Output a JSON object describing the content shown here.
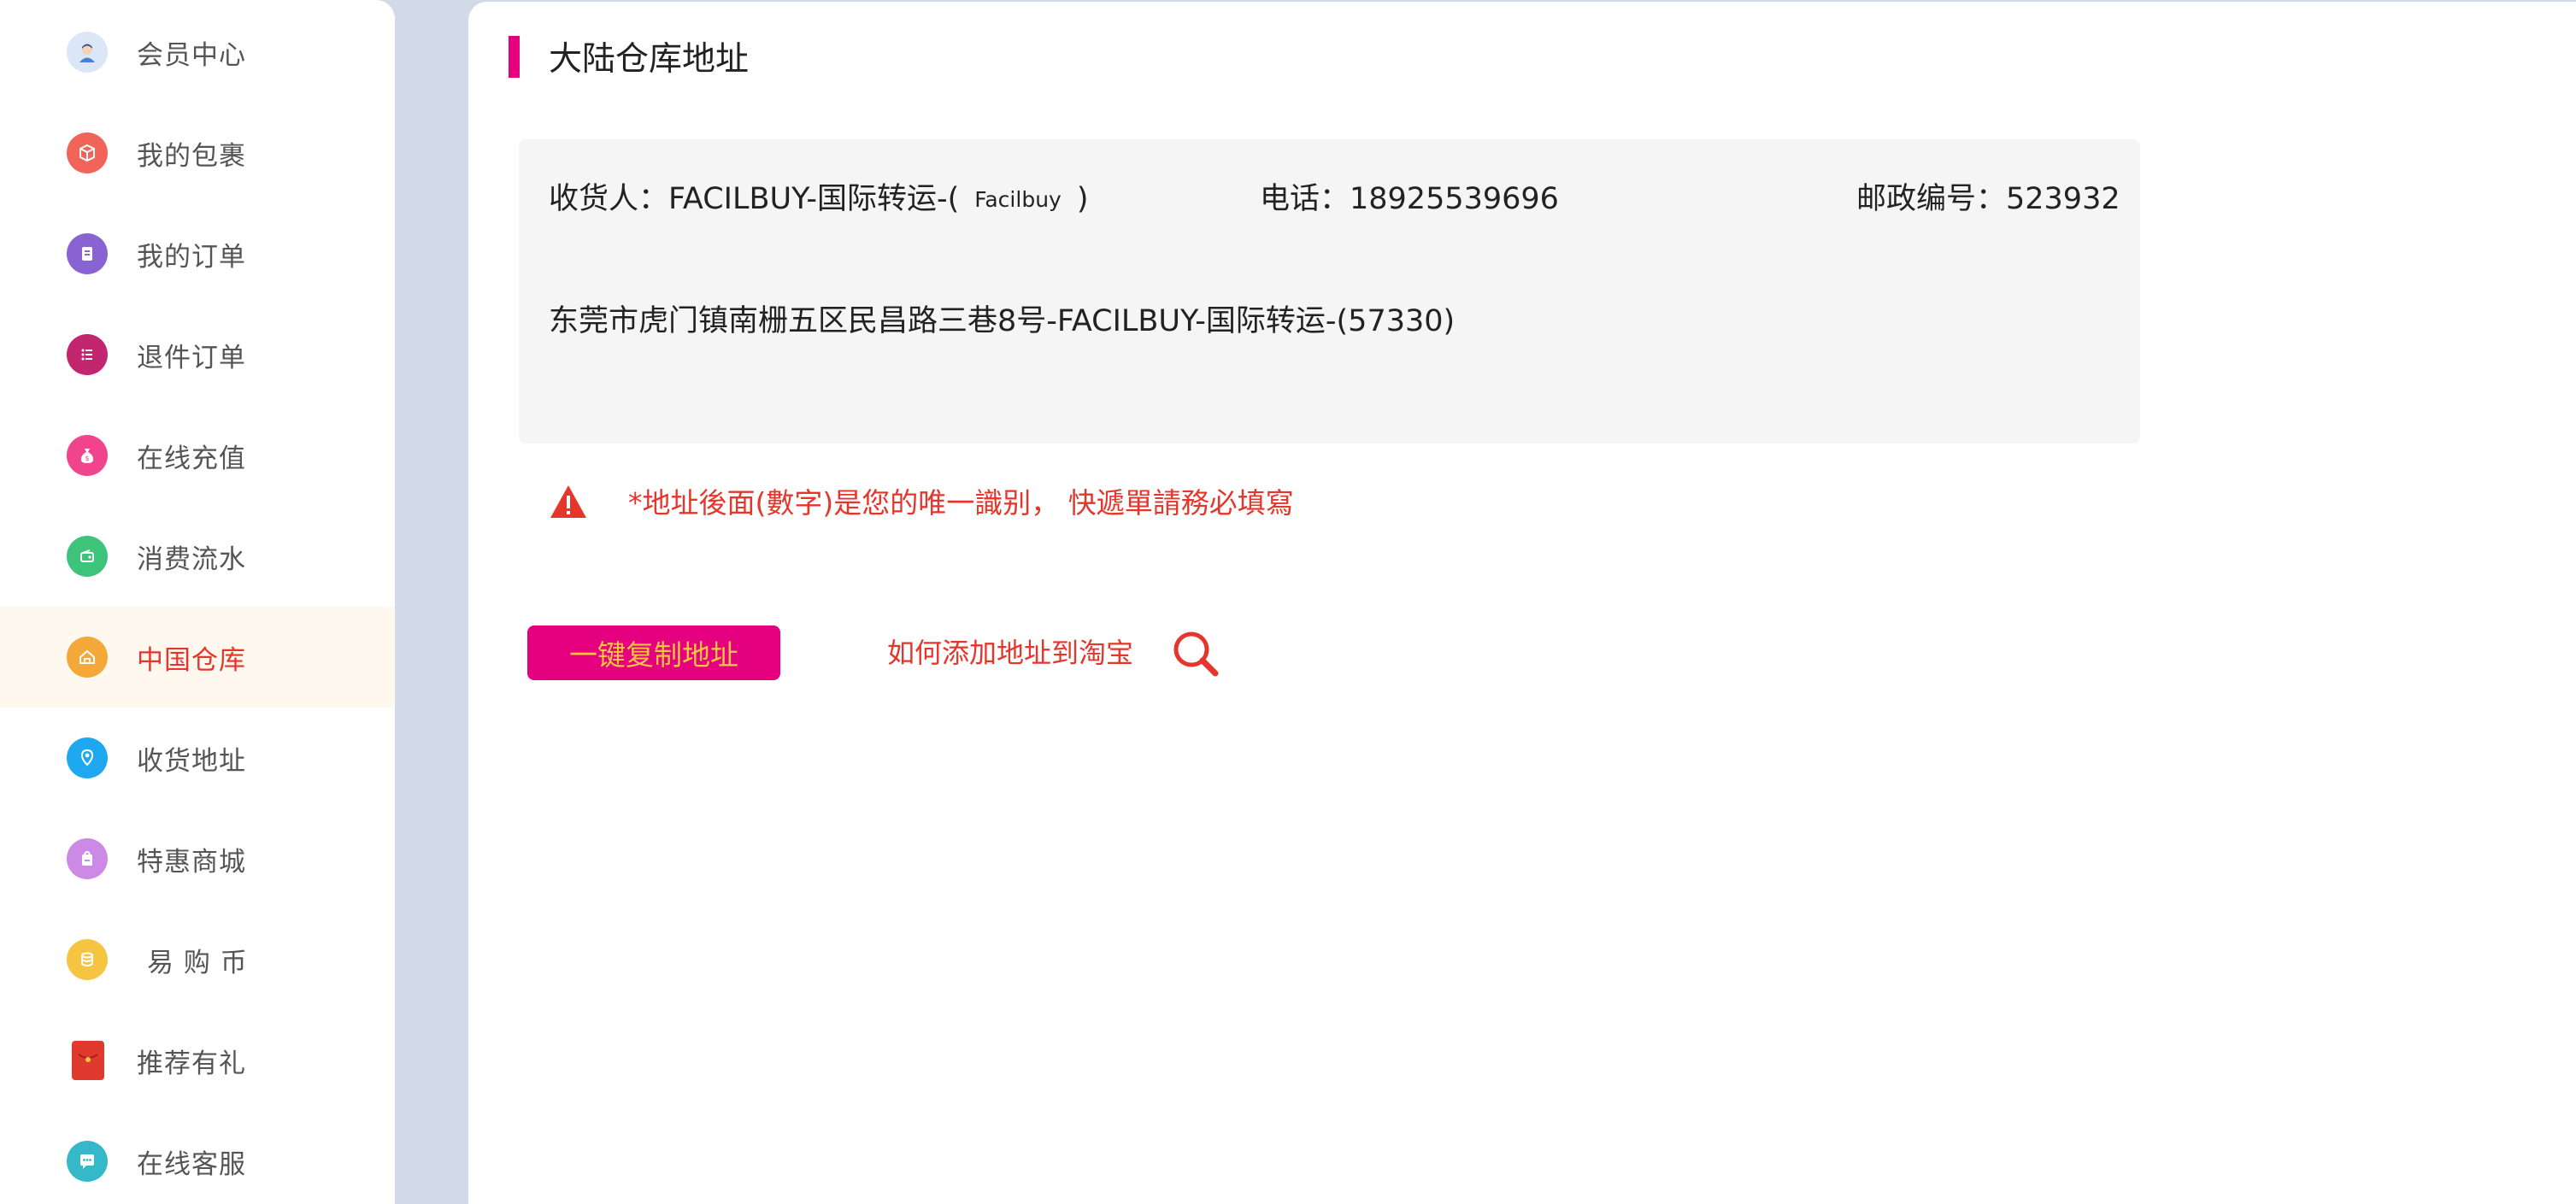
{
  "sidebar": {
    "items": [
      {
        "label": "会员中心",
        "icon": "avatar-icon",
        "color": "#8fb3e6",
        "active": false
      },
      {
        "label": "我的包裹",
        "icon": "package-icon",
        "color": "#f0645a",
        "active": false
      },
      {
        "label": "我的订单",
        "icon": "order-icon",
        "color": "#8a63d2",
        "active": false
      },
      {
        "label": "退件订单",
        "icon": "return-list-icon",
        "color": "#c2266f",
        "active": false
      },
      {
        "label": "在线充值",
        "icon": "money-bag-icon",
        "color": "#f0448c",
        "active": false
      },
      {
        "label": "消费流水",
        "icon": "wallet-flow-icon",
        "color": "#3ec47a",
        "active": false
      },
      {
        "label": "中国仓库",
        "icon": "warehouse-icon",
        "color": "#f5a83a",
        "active": true
      },
      {
        "label": "收货地址",
        "icon": "location-pin-icon",
        "color": "#1ea8f0",
        "active": false
      },
      {
        "label": "特惠商城",
        "icon": "shopping-bag-icon",
        "color": "#cc8ae6",
        "active": false
      },
      {
        "label": "易 购 币",
        "icon": "coin-icon",
        "color": "#f5c542",
        "active": false
      },
      {
        "label": "推荐有礼",
        "icon": "red-envelope-icon",
        "color": "#e03a2f",
        "active": false
      },
      {
        "label": "在线客服",
        "icon": "chat-bubble-icon",
        "color": "#35b8c8",
        "active": false
      }
    ]
  },
  "main": {
    "title": "大陆仓库地址",
    "info": {
      "receiver_prefix": "收货人：FACILBUY-国际转运-(",
      "receiver_name": "Facilbuy",
      "receiver_suffix": ")",
      "phone": "电话：18925539696",
      "postcode": "邮政编号：523932",
      "address": "东莞市虎门镇南栅五区民昌路三巷8号-FACILBUY-国际转运-(57330)"
    },
    "warning": "*地址後面(數字)是您的唯一識别， 快遞單請務必填寫",
    "copy_button": "一键复制地址",
    "help_link": "如何添加地址到淘宝"
  },
  "colors": {
    "accent_pink": "#e5007f",
    "warning_red": "#e5362c",
    "button_text": "#f5c542",
    "background": "#d3dae7"
  }
}
